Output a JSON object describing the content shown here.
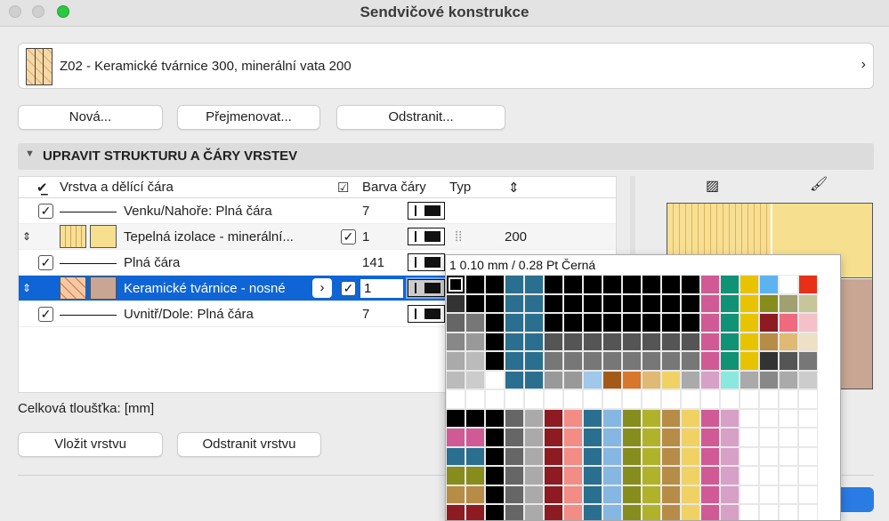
{
  "window": {
    "title": "Sendvičové konstrukce"
  },
  "selector": {
    "label": "Z02 - Keramické tvárnice 300, minerální vata 200"
  },
  "buttons": {
    "new": "Nová...",
    "rename": "Přejmenovat...",
    "delete": "Odstranit..."
  },
  "section": {
    "title": "UPRAVIT STRUKTURU A ČÁRY VRSTEV"
  },
  "table": {
    "headers": {
      "layer": "Vrstva a dělící čára",
      "pen": "Barva čáry",
      "type": "Typ"
    },
    "rows": [
      {
        "name": "Venku/Nahoře: Plná čára",
        "pen": "7",
        "thick": ""
      },
      {
        "name": "Tepelná izolace - minerální...",
        "pen": "1",
        "thick": "200"
      },
      {
        "name": "Plná čára",
        "pen": "141",
        "thick": ""
      },
      {
        "name": "Keramické tvárnice - nosné",
        "pen": "1",
        "thick": ""
      },
      {
        "name": "Uvnitř/Dole: Plná čára",
        "pen": "7",
        "thick": ""
      }
    ]
  },
  "total": {
    "label": "Celková tloušťka: [mm]"
  },
  "bottom_buttons": {
    "insert": "Vložit vrstvu",
    "remove": "Odstranit vrstvu"
  },
  "palette": {
    "info": "1  0.10 mm /  0.28 Pt Černá"
  },
  "colors": {
    "accent": "#0f65d6"
  }
}
